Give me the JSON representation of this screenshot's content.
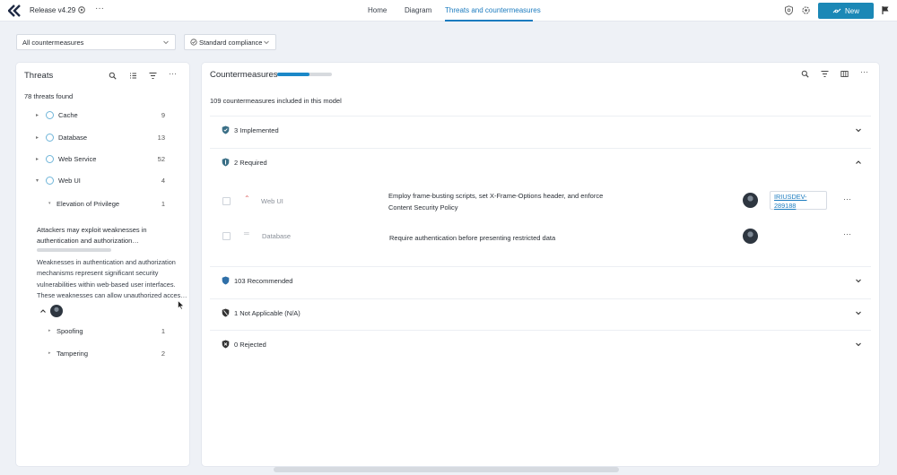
{
  "header": {
    "release": "Release v4.29",
    "nav": [
      "Home",
      "Diagram",
      "Threats and countermeasures"
    ],
    "new_button": "New",
    "colors": {
      "accent": "#1b88b6",
      "link": "#1b7bbf"
    }
  },
  "filters": {
    "countermeasures_filter": "All countermeasures",
    "compliance_filter": "Standard compliance"
  },
  "threats": {
    "title": "Threats",
    "count_text": "78 threats found",
    "components": [
      {
        "label": "Cache",
        "count": "9"
      },
      {
        "label": "Database",
        "count": "13"
      },
      {
        "label": "Web Service",
        "count": "52"
      },
      {
        "label": "Web UI",
        "count": "4"
      }
    ],
    "categories": [
      {
        "label": "Elevation of Privilege",
        "count": "1"
      },
      {
        "label": "Spoofing",
        "count": "1"
      },
      {
        "label": "Tampering",
        "count": "2"
      }
    ],
    "selected": {
      "title": "Attackers may exploit weaknesses in authentication and authorization…",
      "description": "Weaknesses in authentication and authorization mechanisms represent significant security vulnerabilities within web-based user interfaces. These weaknesses can allow unauthorized acces…"
    }
  },
  "countermeasures": {
    "title": "Countermeasures",
    "progress_fraction": 0.59,
    "count_text": "109 countermeasures included in this model",
    "sections": [
      {
        "label": "3 Implemented",
        "icon": "shield-check-icon"
      },
      {
        "label": "2 Required",
        "icon": "shield-half-icon"
      },
      {
        "label": "103 Recommended",
        "icon": "shield-icon"
      },
      {
        "label": "1 Not Applicable (N/A)",
        "icon": "shield-na-icon"
      },
      {
        "label": "0 Rejected",
        "icon": "shield-x-icon"
      }
    ],
    "required_rows": [
      {
        "component": "Web UI",
        "description": "Employ frame-busting scripts, set X-Frame-Options header, and enforce Content Security Policy",
        "issue": "IRIUSDEV-289188",
        "priority": "high"
      },
      {
        "component": "Database",
        "description": "Require authentication before presenting restricted data",
        "issue": "",
        "priority": "medium"
      }
    ]
  }
}
